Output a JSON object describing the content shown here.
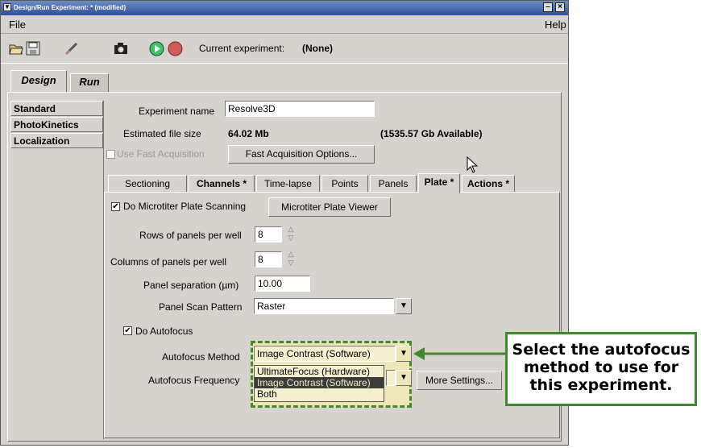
{
  "window": {
    "title": "Design/Run Experiment:  * (modified)",
    "minimize_label": "–",
    "close_label": "×"
  },
  "menubar": {
    "file": "File",
    "help": "Help"
  },
  "toolbar": {
    "icons": [
      "open-icon",
      "save-icon",
      "clear-icon",
      "camera-icon",
      "play-icon",
      "stop-icon"
    ],
    "current_label": "Current experiment:",
    "current_value": "(None)"
  },
  "main_tabs": [
    "Design",
    "Run"
  ],
  "sidebar": {
    "items": [
      "Standard",
      "PhotoKinetics",
      "Localization"
    ]
  },
  "experiment": {
    "name_label": "Experiment name",
    "name_value": "Resolve3D",
    "size_label": "Estimated file size",
    "size_value": "64.02 Mb",
    "available": "(1535.57 Gb Available)",
    "fast_acq_label": "Use Fast Acquisition",
    "fast_acq_button": "Fast Acquisition Options..."
  },
  "sub_tabs": [
    "Sectioning",
    "Channels *",
    "Time-lapse",
    "Points",
    "Panels",
    "Plate *",
    "Actions *"
  ],
  "plate": {
    "scan_label": "Do Microtiter Plate Scanning",
    "scan_checked": "✔",
    "viewer_button": "Microtiter Plate Viewer",
    "rows_label": "Rows of panels per well",
    "rows_value": "8",
    "cols_label": "Columns of panels per well",
    "cols_value": "8",
    "sep_label": "Panel separation (µm)",
    "sep_value": "10.00",
    "pattern_label": "Panel Scan Pattern",
    "pattern_value": "Raster",
    "autofocus_label": "Do Autofocus",
    "autofocus_checked": "✔",
    "af_method_label": "Autofocus Method",
    "af_method_value": "Image Contrast (Software)",
    "af_freq_label": "Autofocus Frequency",
    "af_options": [
      "UltimateFocus (Hardware)",
      "Image Contrast (Software)",
      "Both"
    ],
    "more_settings": "More Settings..."
  },
  "callout": {
    "text": "Select the autofocus method to use for this experiment.",
    "color": "#3e8a2c"
  }
}
